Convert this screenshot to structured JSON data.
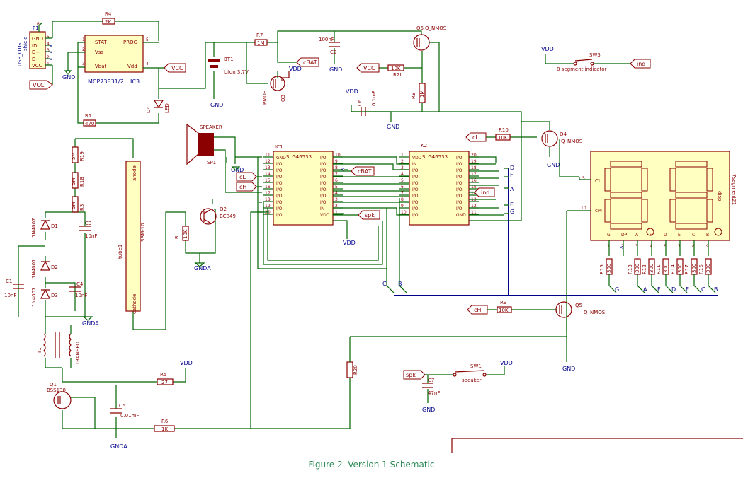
{
  "caption": "Figure 2. Version 1 Schematic",
  "power": {
    "vcc": "VCC",
    "vdd": "VDD",
    "gnd": "GND",
    "gnda": "GNDA",
    "cbat": "cBAT"
  },
  "usb": {
    "ref": "P1",
    "name": "USB_OTG",
    "pins": [
      "GND",
      "ID",
      "D+",
      "D-",
      "VCC"
    ],
    "shield": "shield",
    "nums": [
      "5",
      "4",
      "3",
      "2",
      "1",
      "6"
    ]
  },
  "ic3": {
    "ref": "IC3",
    "name": "MCP73831/2",
    "pins": [
      "STAT",
      "Vss",
      "Vbat",
      "PROG",
      "Vdd"
    ],
    "nums": [
      "1",
      "2",
      "3",
      "5",
      "4"
    ]
  },
  "r4": {
    "ref": "R4",
    "value": "2K"
  },
  "r1": {
    "ref": "R1",
    "value": "470"
  },
  "d4": {
    "ref": "D4",
    "value": "LED"
  },
  "bt1": {
    "ref": "BT1",
    "value": "LiIon 3.7V"
  },
  "r7": {
    "ref": "R7",
    "value": "1M"
  },
  "q3": {
    "ref": "Q3",
    "value": "PMOS"
  },
  "c2": {
    "ref": "C2",
    "value": "100nF"
  },
  "q6": {
    "ref": "Q6",
    "value": "Q_NMOS"
  },
  "r2": {
    "ref": "R2L",
    "value": "10K"
  },
  "r8": {
    "ref": "R8",
    "value": "1M"
  },
  "c6": {
    "ref": "C6",
    "value": "0.1mF"
  },
  "sw3": {
    "ref": "SW3",
    "value": "8 segment indicator"
  },
  "ind": "ind",
  "speaker": {
    "ref": "SP1",
    "value": "SPEAKER"
  },
  "cl": "cL",
  "ch": "cH",
  "spk": "spk",
  "ic1": {
    "ref": "IC1",
    "name": "SLG46533",
    "left": [
      "GND",
      "I/O",
      "I/O",
      "I/O",
      "I/O",
      "I/O",
      "I/O",
      "I/O",
      "I/O",
      "I/O"
    ],
    "leftnums": [
      "11",
      "12",
      "13",
      "14",
      "15",
      "16",
      "17",
      "18",
      "19",
      "20"
    ],
    "right": [
      "I/O",
      "I/O",
      "I/O",
      "I/O",
      "I/O",
      "I/O",
      "I/O",
      "I/O",
      "IN",
      "VDD"
    ],
    "rightnums": [
      "10",
      "9",
      "8",
      "7",
      "6",
      "5",
      "4",
      "3",
      "2",
      "1"
    ]
  },
  "k2": {
    "ref": "K2",
    "name": "SLG46533",
    "left": [
      "VDD",
      "IN",
      "I/O",
      "I/O",
      "I/O",
      "I/O",
      "I/O",
      "I/O",
      "I/O",
      "I/O"
    ],
    "leftnums": [
      "1",
      "2",
      "3",
      "4",
      "5",
      "6",
      "7",
      "8",
      "9",
      "10"
    ],
    "right": [
      "I/O",
      "I/O",
      "I/O",
      "I/O",
      "I/O",
      "I/O",
      "I/O",
      "I/O",
      "I/O",
      "GND"
    ],
    "rightnums": [
      "20",
      "19",
      "18",
      "17",
      "16",
      "15",
      "14",
      "13",
      "12",
      "11"
    ]
  },
  "bus_right": [
    "D",
    "F",
    "A",
    "E",
    "G"
  ],
  "r10": {
    "ref": "R10",
    "value": "10K"
  },
  "q4": {
    "ref": "Q4",
    "value": "Q_NMOS"
  },
  "disp": {
    "ref": "disp",
    "name": "7segment21",
    "cl": "CL",
    "cm": "cM",
    "pin5": "5",
    "pin10": "10",
    "seg_labels": [
      "G",
      "DP",
      "A",
      "F",
      "D",
      "E",
      "C",
      "B"
    ],
    "seg_nums": [
      "1",
      "2",
      "3",
      "4",
      "6",
      "7",
      "8",
      "9"
    ]
  },
  "seg_res": [
    {
      "ref": "R15",
      "value": "300"
    },
    {
      "ref": "R13",
      "value": "300"
    },
    {
      "ref": "R12",
      "value": "300"
    },
    {
      "ref": "R11",
      "value": "300"
    },
    {
      "ref": "R14",
      "value": "300"
    },
    {
      "ref": "R17",
      "value": "300"
    },
    {
      "ref": "R16",
      "value": "300"
    }
  ],
  "bus_bottom": [
    "C",
    "B",
    "G",
    "A",
    "F",
    "D",
    "E",
    "C",
    "B"
  ],
  "r9": {
    "ref": "R9",
    "value": "10K"
  },
  "q5": {
    "ref": "Q5",
    "value": "Q_NMOS"
  },
  "r19": {
    "ref": "R19",
    "value": "5M"
  },
  "r18": {
    "ref": "R18",
    "value": "5M"
  },
  "r3": {
    "ref": "R3",
    "value": "5M"
  },
  "d1": {
    "ref": "D1",
    "value": "1N4007"
  },
  "d2": {
    "ref": "D2",
    "value": "1N4007"
  },
  "d3": {
    "ref": "D3",
    "value": "1N4007"
  },
  "c3": {
    "ref": "C3",
    "value": "10nF"
  },
  "c1": {
    "ref": "C1",
    "value": "10nF"
  },
  "c4": {
    "ref": "C4",
    "value": "10nF"
  },
  "tube": {
    "ref": "tube1",
    "value": "SBM-10",
    "anode": "anode",
    "cathode": "cathode"
  },
  "q2": {
    "ref": "Q2",
    "value": "BC849"
  },
  "r_q2": {
    "ref": "R",
    "value": "10K"
  },
  "transfo": {
    "ref": "T1",
    "value": "TRANSFO"
  },
  "q1": {
    "ref": "Q1",
    "value": "BSS138"
  },
  "r5": {
    "ref": "R5",
    "value": "27"
  },
  "c5": {
    "ref": "C5",
    "value": "0.01mF"
  },
  "r6": {
    "ref": "R6",
    "value": "1K"
  },
  "r20": {
    "ref": "R20",
    "value": ""
  },
  "c7": {
    "ref": "C7",
    "value": "47nF"
  },
  "sw1": {
    "ref": "SW1",
    "value": "speaker"
  },
  "colors": {
    "wire": "#006400",
    "bus": "#00008b",
    "component": "#8b0000",
    "ic_fill": "#ffffc2",
    "caption": "#2e8b57"
  }
}
